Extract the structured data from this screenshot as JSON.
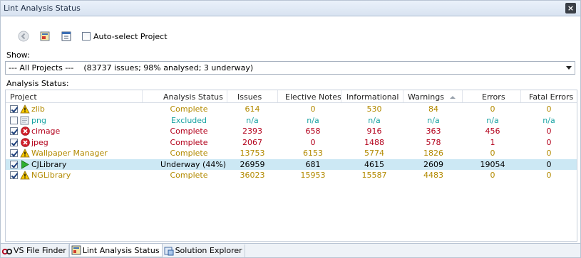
{
  "window": {
    "title": "Lint Analysis Status"
  },
  "toolbar": {
    "auto_select_label": "Auto-select Project",
    "auto_select_checked": false
  },
  "filter": {
    "show_label": "Show:",
    "selected": "--- All Projects ---",
    "summary": "(83737 issues; 98% analysed; 3 underway)"
  },
  "analysis_label": "Analysis Status:",
  "columns": [
    "Project",
    "Analysis Status",
    "Issues",
    "Elective Notes",
    "Informational",
    "Warnings",
    "Errors",
    "Fatal Errors"
  ],
  "sort": {
    "column": "Warnings",
    "direction": "ascending"
  },
  "colors": {
    "complete": "#b38a00",
    "excluded": "#1aa3a3",
    "error": "#b3001b",
    "underway": "#000000",
    "selected_row": "#cce8f4"
  },
  "rows": [
    {
      "project": "zlib",
      "checked": true,
      "icon": "warning-icon",
      "status": "Complete",
      "issues": "614",
      "elective": "0",
      "informational": "530",
      "warnings": "84",
      "errors": "0",
      "fatal": "0",
      "color": "#b38a00",
      "selected": false
    },
    {
      "project": "png",
      "checked": false,
      "icon": "excluded-doc-icon",
      "status": "Excluded",
      "issues": "n/a",
      "elective": "n/a",
      "informational": "n/a",
      "warnings": "n/a",
      "errors": "n/a",
      "fatal": "n/a",
      "color": "#1aa3a3",
      "selected": false
    },
    {
      "project": "cimage",
      "checked": true,
      "icon": "error-icon",
      "status": "Complete",
      "issues": "2393",
      "elective": "658",
      "informational": "916",
      "warnings": "363",
      "errors": "456",
      "fatal": "0",
      "color": "#b3001b",
      "selected": false
    },
    {
      "project": "jpeg",
      "checked": true,
      "icon": "error-icon",
      "status": "Complete",
      "issues": "2067",
      "elective": "0",
      "informational": "1488",
      "warnings": "578",
      "errors": "1",
      "fatal": "0",
      "color": "#b3001b",
      "selected": false
    },
    {
      "project": "Wallpaper Manager",
      "checked": true,
      "icon": "warning-icon",
      "status": "Complete",
      "issues": "13753",
      "elective": "6153",
      "informational": "5774",
      "warnings": "1826",
      "errors": "0",
      "fatal": "0",
      "color": "#b38a00",
      "selected": false
    },
    {
      "project": "CJLibrary",
      "checked": true,
      "icon": "play-icon",
      "status": "Underway (44%)",
      "issues": "26959",
      "elective": "681",
      "informational": "4615",
      "warnings": "2609",
      "errors": "19054",
      "fatal": "0",
      "color": "#000000",
      "selected": true
    },
    {
      "project": "NGLibrary",
      "checked": true,
      "icon": "warning-icon",
      "status": "Complete",
      "issues": "36023",
      "elective": "15953",
      "informational": "15587",
      "warnings": "4483",
      "errors": "0",
      "fatal": "0",
      "color": "#b38a00",
      "selected": false
    }
  ],
  "bottom_tabs": [
    {
      "label": "VS File Finder",
      "icon": "file-finder-icon",
      "active": false
    },
    {
      "label": "Lint Analysis Status",
      "icon": "lint-icon",
      "active": true
    },
    {
      "label": "Solution Explorer",
      "icon": "solution-explorer-icon",
      "active": false
    }
  ]
}
